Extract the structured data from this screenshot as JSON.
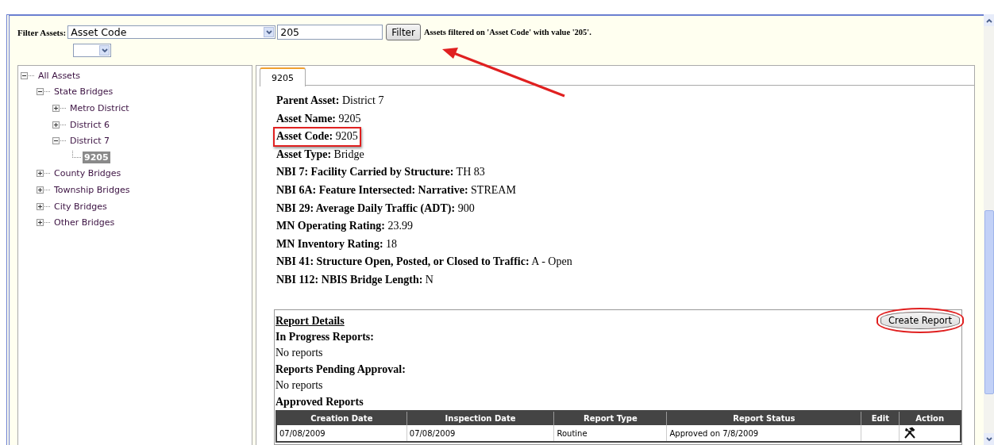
{
  "filter": {
    "label": "Filter Assets:",
    "field": {
      "value": "Asset Code"
    },
    "query": {
      "value": "205"
    },
    "button": "Filter",
    "message": "Assets filtered on 'Asset Code' with value '205'."
  },
  "tree": [
    {
      "label": "All Assets",
      "expanded": true,
      "selected": false,
      "children": [
        {
          "label": "State Bridges",
          "expanded": true,
          "selected": false,
          "children": [
            {
              "label": "Metro District",
              "expanded": false,
              "selected": false
            },
            {
              "label": "District 6",
              "expanded": false,
              "selected": false
            },
            {
              "label": "District 7",
              "expanded": true,
              "selected": false,
              "children": [
                {
                  "label": "9205",
                  "selected": true
                }
              ]
            }
          ]
        },
        {
          "label": "County Bridges",
          "expanded": false,
          "selected": false
        },
        {
          "label": "Township Bridges",
          "expanded": false,
          "selected": false
        },
        {
          "label": "City Bridges",
          "expanded": false,
          "selected": false
        },
        {
          "label": "Other Bridges",
          "expanded": false,
          "selected": false
        }
      ]
    }
  ],
  "tabs": [
    {
      "label": "9205",
      "selected": true
    }
  ],
  "details": [
    {
      "label": "Parent Asset:",
      "value": "District 7",
      "highlighted": false
    },
    {
      "label": "Asset Name:",
      "value": "9205",
      "highlighted": false
    },
    {
      "label": "Asset Code:",
      "value": "9205",
      "highlighted": true
    },
    {
      "label": "Asset Type:",
      "value": "Bridge",
      "highlighted": false
    },
    {
      "label": "NBI 7: Facility Carried by Structure:",
      "value": "TH 83",
      "highlighted": false
    },
    {
      "label": "NBI 6A: Feature Intersected: Narrative:",
      "value": "STREAM",
      "highlighted": false
    },
    {
      "label": "NBI 29: Average Daily Traffic (ADT):",
      "value": "900",
      "highlighted": false
    },
    {
      "label": "MN Operating Rating:",
      "value": "23.99",
      "highlighted": false
    },
    {
      "label": "MN Inventory Rating:",
      "value": "18",
      "highlighted": false
    },
    {
      "label": "NBI 41: Structure Open, Posted, or Closed to Traffic:",
      "value": "A - Open",
      "highlighted": false
    },
    {
      "label": "NBI 112: NBIS Bridge Length:",
      "value": "N",
      "highlighted": false
    }
  ],
  "report": {
    "title": "Report Details",
    "button": {
      "label": "Create Report",
      "highlighted": true
    },
    "sections": [
      {
        "heading": "In Progress Reports:",
        "text": "No reports"
      },
      {
        "heading": "Reports Pending Approval:",
        "text": "No reports"
      }
    ],
    "approved_heading": "Approved Reports",
    "table": {
      "columns": [
        "Creation Date",
        "Inspection Date",
        "Report Type",
        "Report Status",
        "Edit",
        "Action"
      ],
      "rows": [
        [
          "07/08/2009",
          "07/08/2009",
          "Routine",
          "Approved on 7/8/2009",
          "",
          {
            "kind": "tools"
          }
        ]
      ]
    }
  },
  "annotations": [
    {
      "kind": "arrow"
    }
  ]
}
